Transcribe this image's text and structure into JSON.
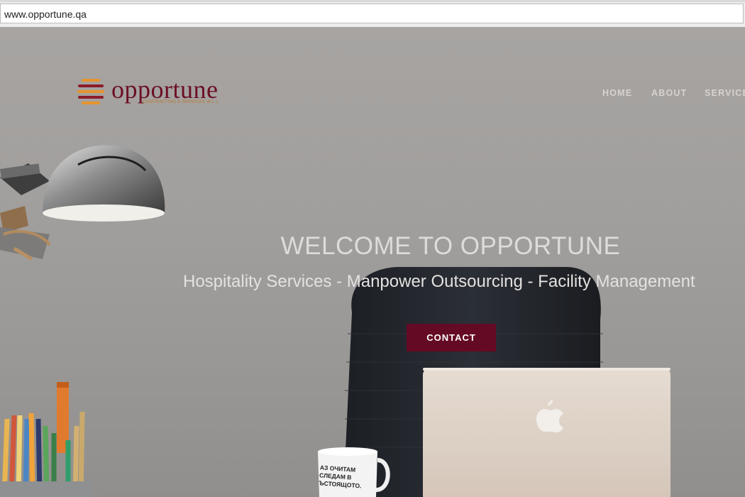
{
  "browser": {
    "url": "www.opportune.qa"
  },
  "logo": {
    "wordmark": "opportune",
    "tagline": "CONTRACTING & SERVICES W.L.L"
  },
  "nav": {
    "items": [
      {
        "label": "HOME"
      },
      {
        "label": "ABOUT"
      },
      {
        "label": "SERVICE"
      }
    ]
  },
  "hero": {
    "title": "WELCOME TO OPPORTUNE",
    "tagline": "Hospitality Services - Manpower Outsourcing - Facility Management",
    "cta_label": "CONTACT"
  },
  "mug": {
    "text": [
      "АЗ ОЧИТАМ",
      "СЛЕДАМ В",
      "ЪСТОЯЩОТО."
    ]
  },
  "colors": {
    "brand": "#650a24",
    "logo_stripe_orange": "#e6932c",
    "logo_stripe_red": "#8c1b2a"
  }
}
